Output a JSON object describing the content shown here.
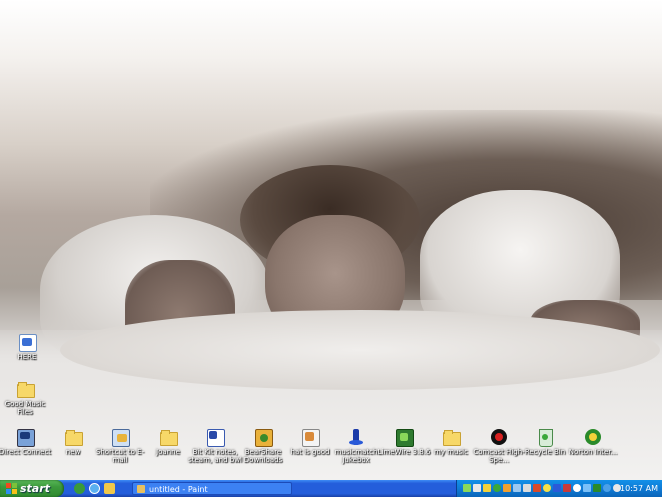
{
  "desktop": {
    "icons": [
      {
        "name": "desktop-icon-here",
        "label": "HERE",
        "icon": "document-icon"
      },
      {
        "name": "desktop-icon-good-music-files",
        "label": "Good Music Files",
        "icon": "folder-icon"
      },
      {
        "name": "desktop-icon-direct-connect",
        "label": "Direct Connect",
        "icon": "computer-network-icon"
      },
      {
        "name": "desktop-icon-new",
        "label": "new",
        "icon": "folder-icon"
      },
      {
        "name": "desktop-icon-shortcut-to-email",
        "label": "Shortcut to E-mail",
        "icon": "email-icon"
      },
      {
        "name": "desktop-icon-joanne",
        "label": "Joanne",
        "icon": "folder-icon"
      },
      {
        "name": "desktop-icon-bit-kit-notes",
        "label": "Bit Kit notes, steam, and bwl",
        "icon": "document-icon"
      },
      {
        "name": "desktop-icon-bearshare-downloads",
        "label": "BearShare Downloads",
        "icon": "bearshare-folder-icon"
      },
      {
        "name": "desktop-icon-hat-is-good",
        "label": "hat is good",
        "icon": "document-icon"
      },
      {
        "name": "desktop-icon-musicmatch-jukebox",
        "label": "musicmatch Jukebox",
        "icon": "musicmatch-icon"
      },
      {
        "name": "desktop-icon-limewire",
        "label": "LimeWire 3.8.6",
        "icon": "limewire-icon"
      },
      {
        "name": "desktop-icon-my-music",
        "label": "my music",
        "icon": "folder-icon"
      },
      {
        "name": "desktop-icon-comcast",
        "label": "Comcast High-Spe...",
        "icon": "comcast-icon"
      },
      {
        "name": "desktop-icon-recycle-bin",
        "label": "Recycle Bin",
        "icon": "recycle-bin-icon"
      },
      {
        "name": "desktop-icon-norton",
        "label": "Norton Inter...",
        "icon": "norton-icon"
      }
    ]
  },
  "taskbar": {
    "start_label": "start",
    "quick_launch": [
      "messenger-icon",
      "internet-explorer-icon",
      "outlook-express-icon"
    ],
    "tasks": [
      {
        "label": "untitled - Paint",
        "icon": "paint-icon"
      }
    ],
    "tray_icons": [
      "network-icon",
      "volume-icon",
      "antivirus-icon",
      "messenger-tray-icon",
      "update-icon",
      "display-icon",
      "printer-icon",
      "firewall-icon",
      "chat-icon",
      "music-icon",
      "security-icon",
      "info-icon",
      "wifi-icon",
      "shield-icon",
      "globe-icon",
      "power-icon"
    ],
    "clock": "10:57 AM"
  },
  "colors": {
    "taskbar_blue": "#245edb",
    "start_green": "#3c9a3c",
    "tray_blue": "#0f7bd6"
  }
}
